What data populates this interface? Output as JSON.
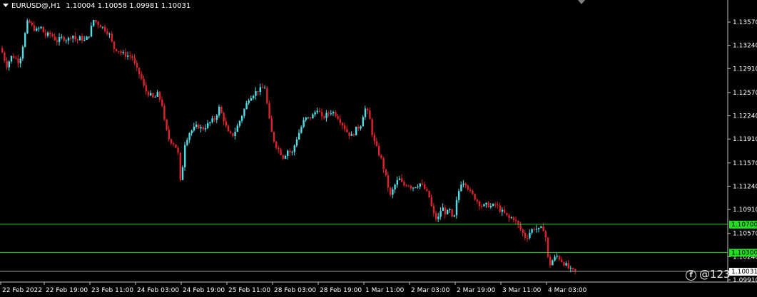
{
  "header": {
    "symbol": "EURUSD@,H1",
    "open": "1.10004",
    "high": "1.10058",
    "low": "1.09981",
    "close": "1.10031"
  },
  "watermark": {
    "text": "@123",
    "icon": "facebook-icon"
  },
  "colors": {
    "background": "#000000",
    "bull": "#4de0e8",
    "bear": "#e0202a",
    "level_line": "#33cc33",
    "level_label_bg": "#22dd22",
    "price_label_bg": "#ffffff",
    "axis": "#c0c0c0"
  },
  "chart_data": {
    "type": "candlestick",
    "price_axis": {
      "range": [
        1.098,
        1.1375
      ],
      "ticks": [
        "1.13570",
        "1.13240",
        "1.12910",
        "1.12570",
        "1.12240",
        "1.11910",
        "1.11570",
        "1.11240",
        "1.10910",
        "1.10570",
        "1.10240",
        "1.09910"
      ]
    },
    "time_axis": {
      "labels": [
        "22 Feb 2022",
        "22 Feb 19:00",
        "23 Feb 11:00",
        "24 Feb 03:00",
        "24 Feb 19:00",
        "25 Feb 11:00",
        "28 Feb 03:00",
        "28 Feb 19:00",
        "1 Mar 11:00",
        "2 Mar 03:00",
        "2 Mar 19:00",
        "3 Mar 11:00",
        "4 Mar 03:00"
      ]
    },
    "levels": [
      {
        "price": 1.107,
        "label": "1.10700"
      },
      {
        "price": 1.103,
        "label": "1.10300"
      }
    ],
    "current_price": {
      "price": 1.10031,
      "label": "1.10031"
    },
    "path": [
      [
        0,
        1.132
      ],
      [
        8,
        1.1295
      ],
      [
        16,
        1.131
      ],
      [
        26,
        1.13
      ],
      [
        32,
        1.133
      ],
      [
        38,
        1.136
      ],
      [
        44,
        1.135
      ],
      [
        50,
        1.1345
      ],
      [
        56,
        1.135
      ],
      [
        62,
        1.1338
      ],
      [
        70,
        1.134
      ],
      [
        78,
        1.133
      ],
      [
        86,
        1.1335
      ],
      [
        94,
        1.1332
      ],
      [
        100,
        1.134
      ],
      [
        106,
        1.133
      ],
      [
        112,
        1.1335
      ],
      [
        118,
        1.133
      ],
      [
        124,
        1.134
      ],
      [
        130,
        1.136
      ],
      [
        136,
        1.1355
      ],
      [
        142,
        1.135
      ],
      [
        148,
        1.1345
      ],
      [
        152,
        1.134
      ],
      [
        158,
        1.132
      ],
      [
        164,
        1.1318
      ],
      [
        170,
        1.1312
      ],
      [
        176,
        1.131
      ],
      [
        184,
        1.1308
      ],
      [
        190,
        1.129
      ],
      [
        196,
        1.128
      ],
      [
        202,
        1.126
      ],
      [
        208,
        1.1255
      ],
      [
        214,
        1.1248
      ],
      [
        220,
        1.1255
      ],
      [
        226,
        1.124
      ],
      [
        230,
        1.121
      ],
      [
        236,
        1.119
      ],
      [
        242,
        1.1185
      ],
      [
        248,
        1.1175
      ],
      [
        252,
        1.1125
      ],
      [
        258,
        1.1185
      ],
      [
        264,
        1.12
      ],
      [
        270,
        1.1205
      ],
      [
        276,
        1.121
      ],
      [
        282,
        1.1205
      ],
      [
        288,
        1.121
      ],
      [
        294,
        1.1215
      ],
      [
        300,
        1.122
      ],
      [
        306,
        1.1235
      ],
      [
        312,
        1.122
      ],
      [
        318,
        1.12
      ],
      [
        324,
        1.1195
      ],
      [
        330,
        1.1205
      ],
      [
        336,
        1.122
      ],
      [
        342,
        1.1235
      ],
      [
        348,
        1.125
      ],
      [
        354,
        1.1255
      ],
      [
        360,
        1.126
      ],
      [
        366,
        1.1262
      ],
      [
        370,
        1.1265
      ],
      [
        378,
        1.1205
      ],
      [
        384,
        1.1185
      ],
      [
        390,
        1.1175
      ],
      [
        396,
        1.1165
      ],
      [
        402,
        1.1175
      ],
      [
        408,
        1.117
      ],
      [
        414,
        1.119
      ],
      [
        420,
        1.1205
      ],
      [
        426,
        1.122
      ],
      [
        432,
        1.122
      ],
      [
        438,
        1.1225
      ],
      [
        444,
        1.1235
      ],
      [
        450,
        1.122
      ],
      [
        456,
        1.1225
      ],
      [
        462,
        1.123
      ],
      [
        468,
        1.1228
      ],
      [
        474,
        1.122
      ],
      [
        480,
        1.121
      ],
      [
        486,
        1.12
      ],
      [
        492,
        1.1195
      ],
      [
        498,
        1.1205
      ],
      [
        504,
        1.121
      ],
      [
        510,
        1.1235
      ],
      [
        516,
        1.1225
      ],
      [
        522,
        1.119
      ],
      [
        528,
        1.1175
      ],
      [
        534,
        1.116
      ],
      [
        540,
        1.1135
      ],
      [
        546,
        1.111
      ],
      [
        552,
        1.1125
      ],
      [
        558,
        1.1135
      ],
      [
        564,
        1.1125
      ],
      [
        570,
        1.1128
      ],
      [
        576,
        1.1122
      ],
      [
        582,
        1.1125
      ],
      [
        588,
        1.1128
      ],
      [
        594,
        1.112
      ],
      [
        600,
        1.111
      ],
      [
        606,
        1.1085
      ],
      [
        612,
        1.1075
      ],
      [
        618,
        1.1095
      ],
      [
        624,
        1.1085
      ],
      [
        630,
        1.109
      ],
      [
        634,
        1.107
      ],
      [
        640,
        1.111
      ],
      [
        646,
        1.1132
      ],
      [
        652,
        1.1128
      ],
      [
        658,
        1.1115
      ],
      [
        664,
        1.1108
      ],
      [
        670,
        1.11
      ],
      [
        676,
        1.1095
      ],
      [
        682,
        1.1098
      ],
      [
        688,
        1.1095
      ],
      [
        694,
        1.1098
      ],
      [
        700,
        1.109
      ],
      [
        706,
        1.1085
      ],
      [
        712,
        1.1078
      ],
      [
        718,
        1.108
      ],
      [
        724,
        1.107
      ],
      [
        730,
        1.106
      ],
      [
        736,
        1.105
      ],
      [
        742,
        1.106
      ],
      [
        748,
        1.1065
      ],
      [
        754,
        1.1062
      ],
      [
        760,
        1.1065
      ],
      [
        764,
        1.105
      ],
      [
        768,
        1.101
      ],
      [
        774,
        1.102
      ],
      [
        780,
        1.1025
      ],
      [
        786,
        1.1018
      ],
      [
        792,
        1.1012
      ],
      [
        798,
        1.1005
      ],
      [
        804,
        1.1003
      ]
    ]
  }
}
